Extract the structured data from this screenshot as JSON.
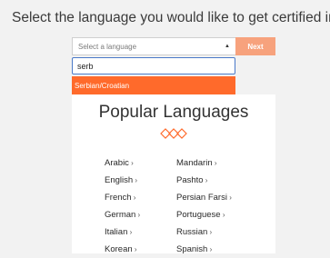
{
  "prompt": "Select the language you would like to get certified in:",
  "select": {
    "placeholder": "Select a language",
    "next_label": "Next",
    "search_value": "serb",
    "highlighted_option": "Serbian/Croatian"
  },
  "popular": {
    "title": "Popular Languages",
    "left": [
      "Arabic",
      "English",
      "French",
      "German",
      "Italian",
      "Korean"
    ],
    "right": [
      "Mandarin",
      "Pashto",
      "Persian Farsi",
      "Portuguese",
      "Russian",
      "Spanish"
    ]
  },
  "colors": {
    "accent": "#ff6a2b",
    "next_button": "#f7a27d",
    "focus_border": "#4a79c8"
  }
}
